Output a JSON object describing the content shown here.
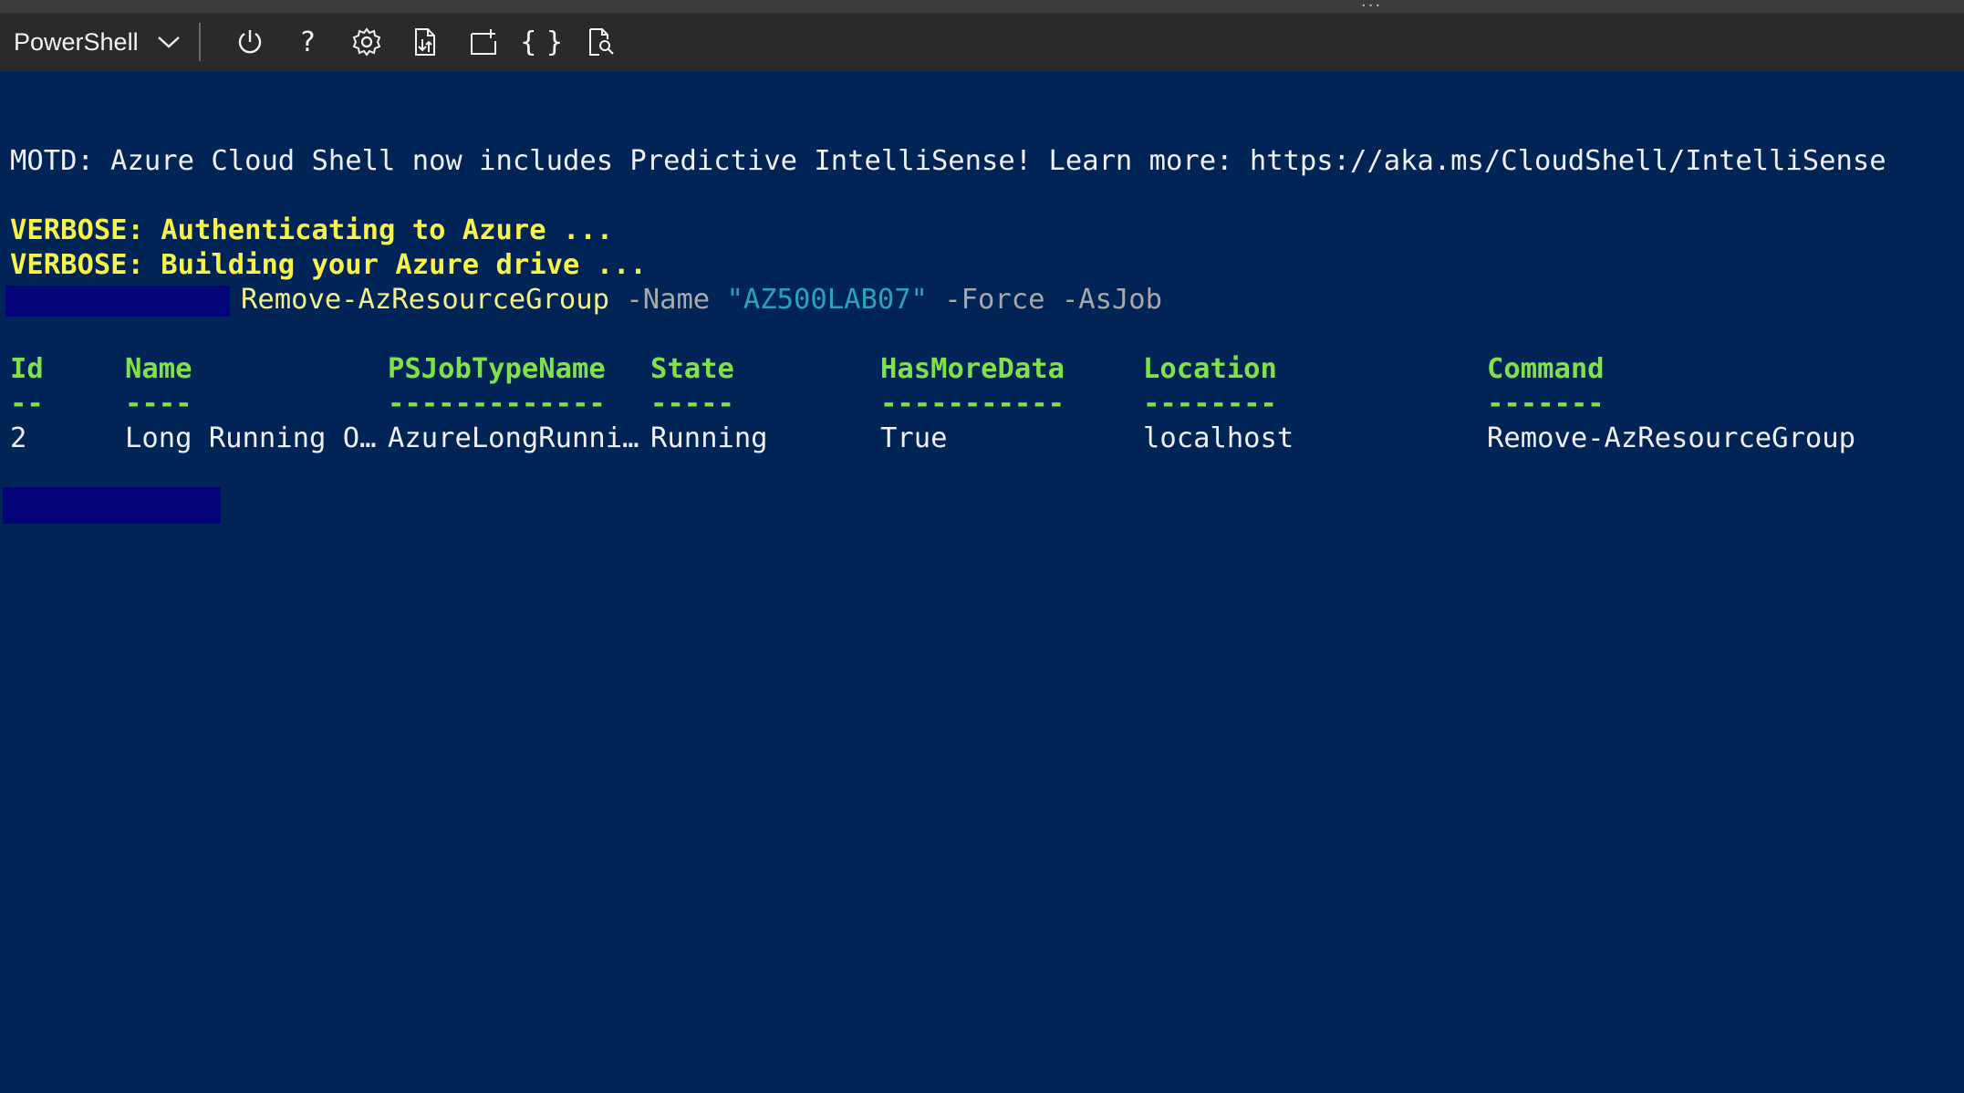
{
  "toolbar": {
    "shell_label": "PowerShell",
    "buttons": [
      {
        "name": "power-icon",
        "glyph": ""
      },
      {
        "name": "help-icon",
        "glyph": "?"
      },
      {
        "name": "settings-icon",
        "glyph": ""
      },
      {
        "name": "upload-download-icon",
        "glyph": ""
      },
      {
        "name": "new-session-icon",
        "glyph": ""
      },
      {
        "name": "editor-icon",
        "glyph": "{ }"
      },
      {
        "name": "web-preview-icon",
        "glyph": ""
      }
    ]
  },
  "terminal": {
    "motd": "MOTD: Azure Cloud Shell now includes Predictive IntelliSense! Learn more: https://aka.ms/CloudShell/IntelliSense",
    "verbose1": "VERBOSE: Authenticating to Azure ...",
    "verbose2": "VERBOSE: Building your Azure drive ...",
    "command": {
      "cmdlet": "Remove-AzResourceGroup",
      "param1": "-Name",
      "value1": "\"AZ500LAB07\"",
      "param2": "-Force",
      "param3": "-AsJob"
    },
    "table": {
      "headers": [
        "Id",
        "Name",
        "PSJobTypeName",
        "State",
        "HasMoreData",
        "Location",
        "Command"
      ],
      "underlines": [
        "--",
        "----",
        "-------------",
        "-----",
        "-----------",
        "--------",
        "-------"
      ],
      "row": [
        "2",
        "Long Running O…",
        "AzureLongRunni…",
        "Running",
        "True",
        "localhost",
        "Remove-AzResourceGroup"
      ]
    }
  },
  "colors": {
    "background": "#012456",
    "toolbar": "#2a2a2a",
    "verbose": "#f7f34a",
    "header": "#7ee24a",
    "parameter": "#a8a8a8",
    "string": "#2aa3b8",
    "redaction": "#04047a"
  }
}
